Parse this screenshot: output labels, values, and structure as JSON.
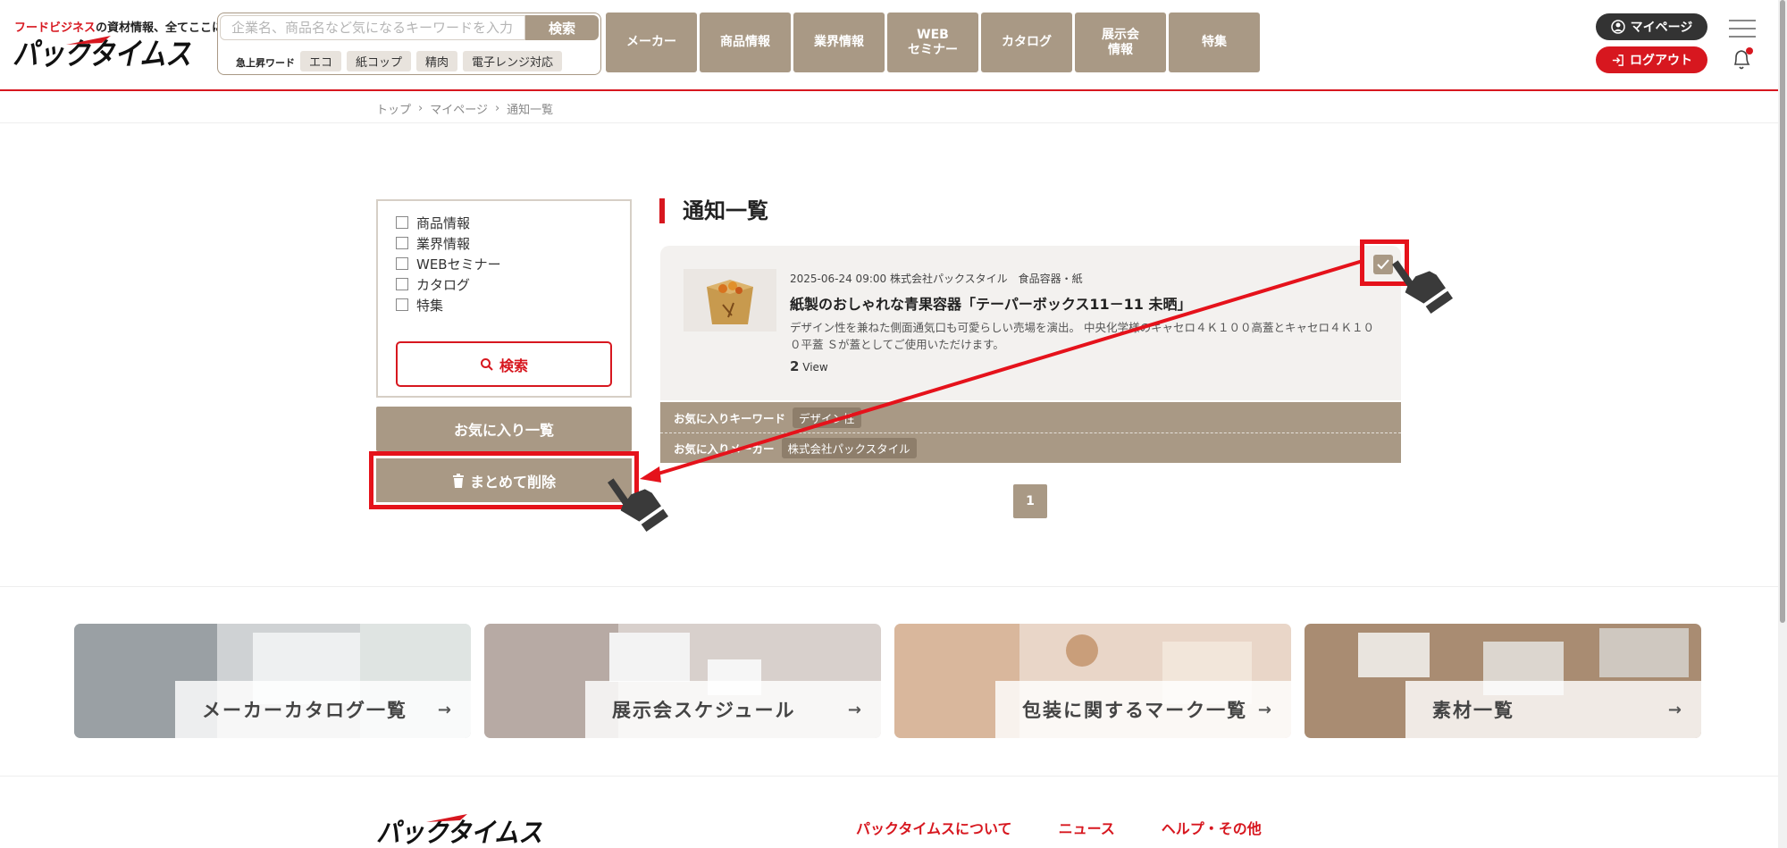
{
  "header": {
    "tagline_red": "フードビジネス",
    "tagline_rest": "の資材情報、全てここに",
    "logo_text": "パックタイムス",
    "search": {
      "placeholder": "企業名、商品名など気になるキーワードを入力",
      "button": "検索"
    },
    "trending_label": "急上昇ワード",
    "trending_tags": [
      "エコ",
      "紙コップ",
      "精肉",
      "電子レンジ対応"
    ],
    "nav": [
      "メーカー",
      "商品情報",
      "業界情報",
      "WEB\nセミナー",
      "カタログ",
      "展示会\n情報",
      "特集"
    ],
    "mypage": "マイページ",
    "logout": "ログアウト"
  },
  "breadcrumb": [
    "トップ",
    "マイページ",
    "通知一覧"
  ],
  "sidebar": {
    "filters": [
      "商品情報",
      "業界情報",
      "WEBセミナー",
      "カタログ",
      "特集"
    ],
    "search_button": "検索",
    "favorites_button": "お気に入り一覧",
    "bulk_delete_button": "まとめて削除"
  },
  "main": {
    "title": "通知一覧",
    "notice": {
      "meta": "2025-06-24 09:00 株式会社パックスタイル　食品容器・紙",
      "title": "紙製のおしゃれな青果容器「テーパーボックス11－11 未晒」",
      "desc": "デザイン性を兼ねた側面通気口も可愛らしい売場を演出。 中央化学様のキャセロ４Ｋ１００高蓋とキャセロ４Ｋ１００平蓋 Ｓが蓋としてご使用いただけます。",
      "views_count": "2",
      "views_label": "View",
      "checked": true
    },
    "fav_keyword_label": "お気に入りキーワード",
    "fav_keyword": "デザイン性",
    "fav_maker_label": "お気に入りメーカー",
    "fav_maker": "株式会社パックスタイル",
    "pagination": [
      "1"
    ]
  },
  "banners": [
    {
      "label": "メーカーカタログ一覧",
      "arrow": "→"
    },
    {
      "label": "展示会スケジュール",
      "arrow": "→"
    },
    {
      "label": "包装に関するマーク一覧",
      "arrow": "→"
    },
    {
      "label": "素材一覧",
      "arrow": "→"
    }
  ],
  "footer": {
    "links": [
      "パックタイムスについて",
      "ニュース",
      "ヘルプ・その他"
    ]
  },
  "colors": {
    "brand_red": "#d7171f",
    "taupe": "#a99985",
    "annotation_red": "#e5121b"
  }
}
